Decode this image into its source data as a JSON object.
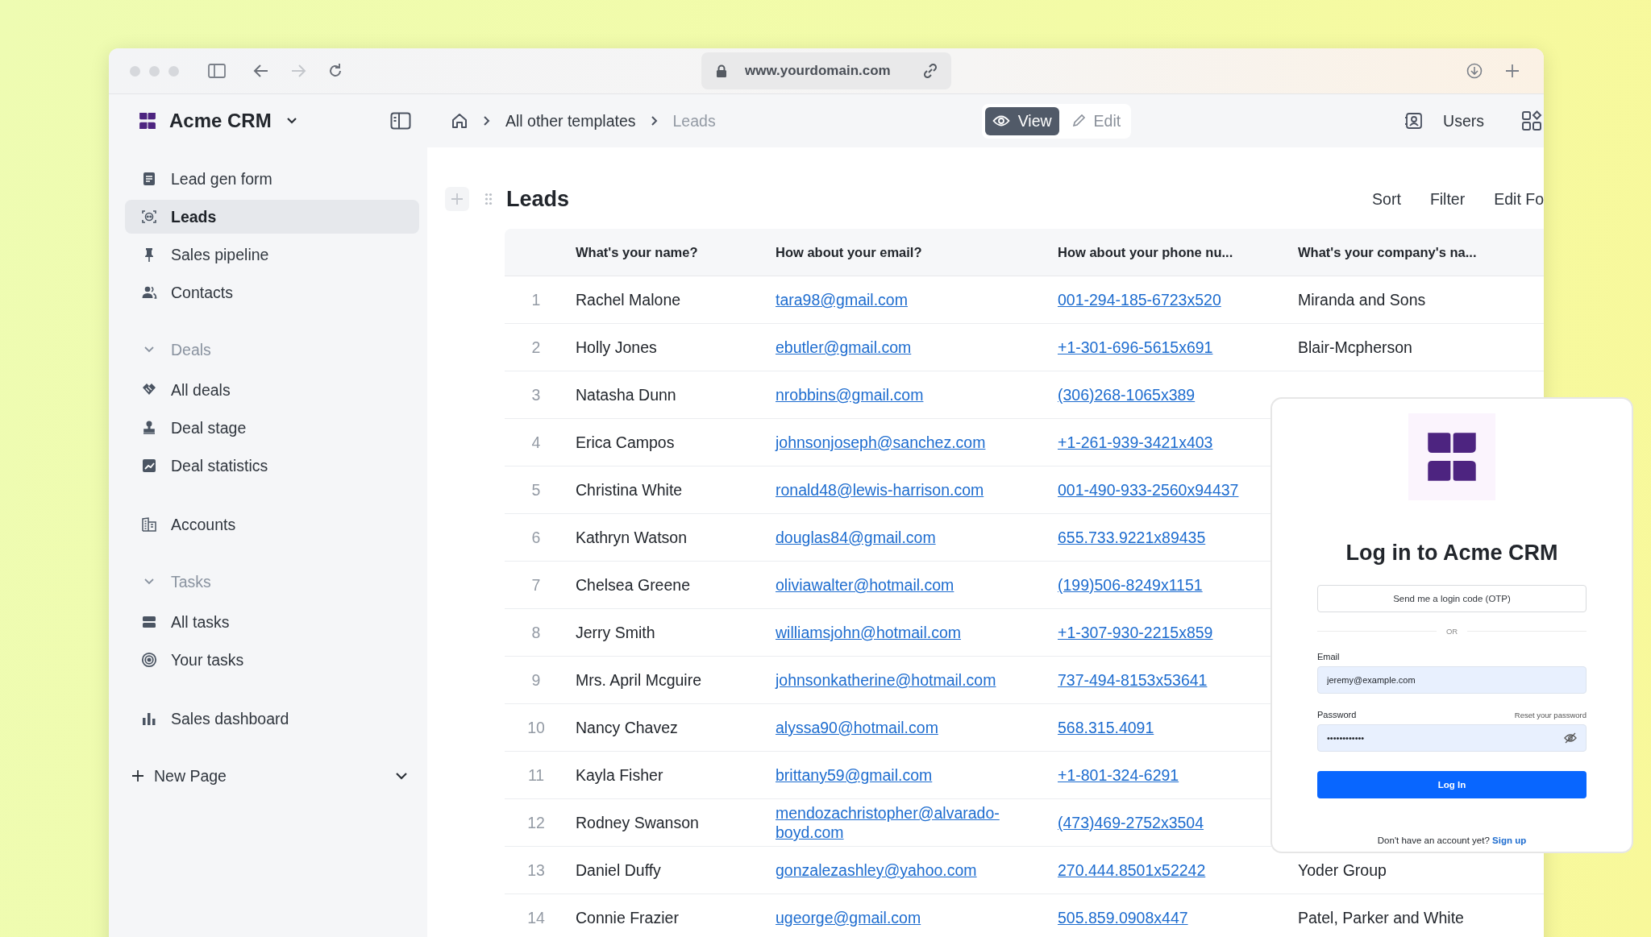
{
  "browser": {
    "url": "www.yourdomain.com"
  },
  "app": {
    "name": "Acme CRM"
  },
  "breadcrumb": [
    {
      "label": "All other templates",
      "current": false
    },
    {
      "label": "Leads",
      "current": true
    }
  ],
  "mode_toggle": [
    {
      "label": "View",
      "selected": true
    },
    {
      "label": "Edit",
      "selected": false
    }
  ],
  "users_button": {
    "label": "Users"
  },
  "sidebar": {
    "items": [
      {
        "kind": "link",
        "label": "Lead gen form",
        "selected": false
      },
      {
        "kind": "link",
        "label": "Leads",
        "selected": true
      },
      {
        "kind": "link",
        "label": "Sales pipeline",
        "selected": false
      },
      {
        "kind": "link",
        "label": "Contacts",
        "selected": false
      },
      {
        "kind": "section",
        "label": "Deals",
        "expanded": true,
        "children": [
          {
            "label": "All deals",
            "selected": false
          },
          {
            "label": "Deal stage",
            "selected": false
          },
          {
            "label": "Deal statistics",
            "selected": false
          }
        ]
      },
      {
        "kind": "link",
        "label": "Accounts",
        "selected": false
      },
      {
        "kind": "section",
        "label": "Tasks",
        "expanded": true,
        "children": [
          {
            "label": "All tasks",
            "selected": false
          },
          {
            "label": "Your tasks",
            "selected": false
          }
        ]
      },
      {
        "kind": "link",
        "label": "Sales dashboard",
        "selected": false
      }
    ],
    "new_page": {
      "label": "New Page"
    }
  },
  "page": {
    "title": "Leads",
    "actions": [
      "Sort",
      "Filter",
      "Edit Fo"
    ]
  },
  "table": {
    "columns": [
      "What's your name?",
      "How about your email?",
      "How about your phone nu...",
      "What's your company's na..."
    ],
    "rows": [
      {
        "number": "1",
        "name": "Rachel Malone",
        "email": "tara98@gmail.com",
        "phone": "001-294-185-6723x520",
        "company": "Miranda and Sons"
      },
      {
        "number": "2",
        "name": "Holly Jones",
        "email": "ebutler@gmail.com",
        "phone": "+1-301-696-5615x691",
        "company": "Blair-Mcpherson"
      },
      {
        "number": "3",
        "name": "Natasha Dunn",
        "email": "nrobbins@gmail.com",
        "phone": "(306)268-1065x389"
      },
      {
        "number": "4",
        "name": "Erica Campos",
        "email": "johnsonjoseph@sanchez.com",
        "phone": "+1-261-939-3421x403"
      },
      {
        "number": "5",
        "name": "Christina White",
        "email": "ronald48@lewis-harrison.com",
        "phone": "001-490-933-2560x94437"
      },
      {
        "number": "6",
        "name": "Kathryn Watson",
        "email": "douglas84@gmail.com",
        "phone": "655.733.9221x89435"
      },
      {
        "number": "7",
        "name": "Chelsea Greene",
        "email": "oliviawalter@hotmail.com",
        "phone": "(199)506-8249x1151"
      },
      {
        "number": "8",
        "name": "Jerry Smith",
        "email": "williamsjohn@hotmail.com",
        "phone": "+1-307-930-2215x859"
      },
      {
        "number": "9",
        "name": "Mrs. April Mcguire",
        "email": "johnsonkatherine@hotmail.com",
        "phone": "737-494-8153x53641"
      },
      {
        "number": "10",
        "name": "Nancy Chavez",
        "email": "alyssa90@hotmail.com",
        "phone": "568.315.4091"
      },
      {
        "number": "11",
        "name": "Kayla Fisher",
        "email": "brittany59@gmail.com",
        "phone": "+1-801-324-6291"
      },
      {
        "number": "12",
        "name": "Rodney Swanson",
        "email": "mendozachristopher@alvarado-boyd.com",
        "phone": "(473)469-2752x3504"
      },
      {
        "number": "13",
        "name": "Daniel Duffy",
        "email": "gonzalezashley@yahoo.com",
        "phone": "270.444.8501x52242",
        "company": "Yoder Group"
      },
      {
        "number": "14",
        "name": "Connie Frazier",
        "email": "ugeorge@gmail.com",
        "phone": "505.859.0908x447",
        "company": "Patel, Parker and White"
      }
    ]
  },
  "login": {
    "title": "Log in to Acme CRM",
    "otp_button": "Send me a login code (OTP)",
    "divider": "OR",
    "email": {
      "label": "Email",
      "value": "jeremy@example.com"
    },
    "password": {
      "label": "Password",
      "reset_link": "Reset your password",
      "value": "••••••••••••"
    },
    "submit": "Log In",
    "footer": {
      "text": "Don't have an account yet?",
      "link": "Sign up"
    }
  }
}
